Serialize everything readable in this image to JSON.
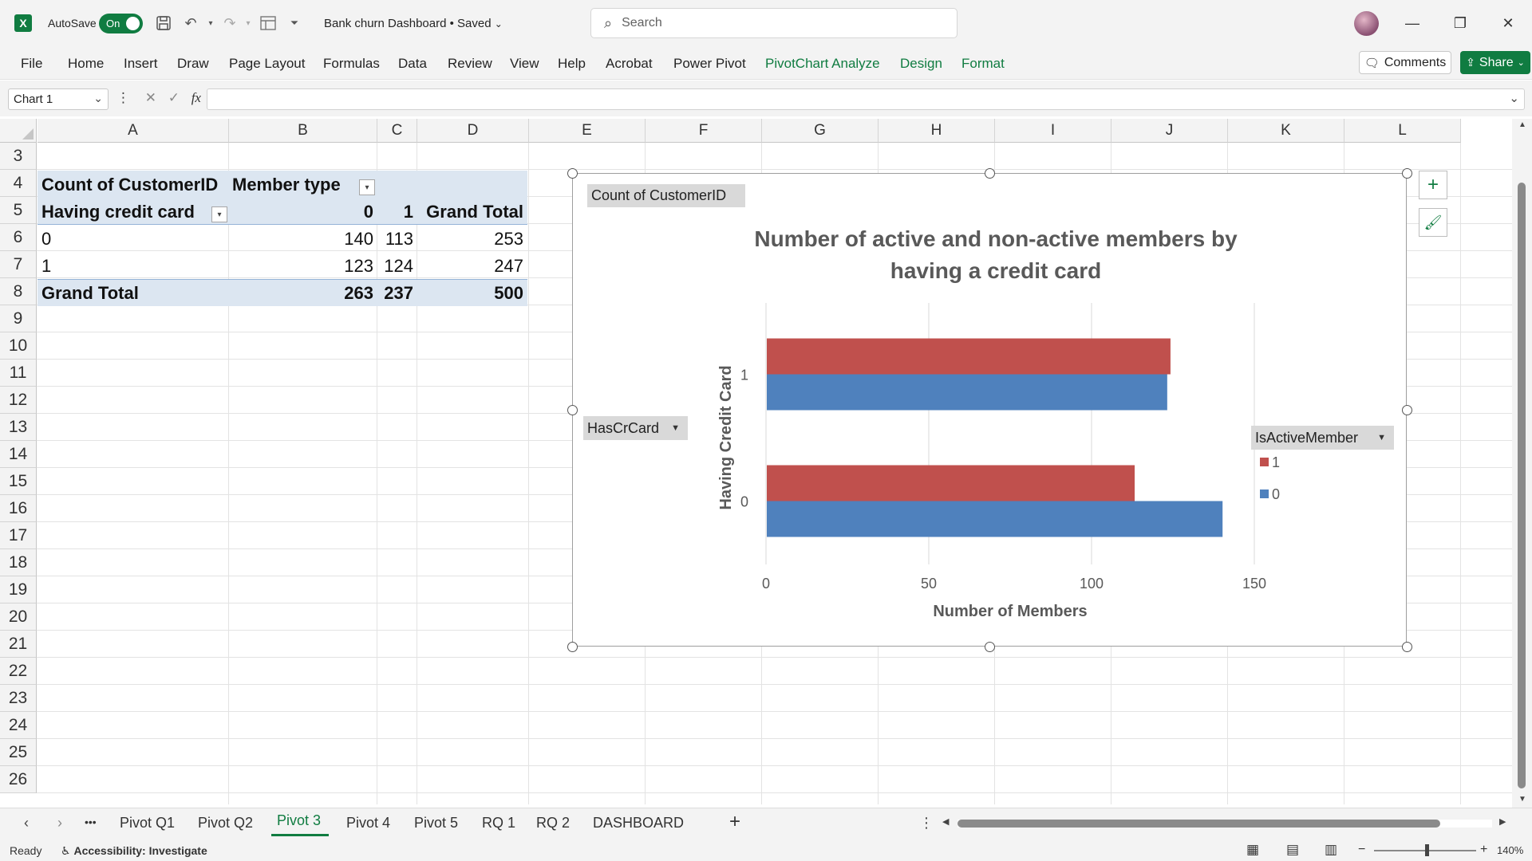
{
  "titlebar": {
    "app_logo": "X",
    "autosave_label": "AutoSave",
    "autosave_state": "On",
    "doc_title": "Bank churn Dashboard • Saved",
    "search_placeholder": "Search",
    "minimize": "—",
    "restore": "❐",
    "close": "✕"
  },
  "ribbon": {
    "tabs": [
      "File",
      "Home",
      "Insert",
      "Draw",
      "Page Layout",
      "Formulas",
      "Data",
      "Review",
      "View",
      "Help",
      "Acrobat",
      "Power Pivot",
      "PivotChart Analyze",
      "Design",
      "Format"
    ],
    "comments_label": "Comments",
    "share_label": "Share",
    "accent_color": "#107c41"
  },
  "formula_bar": {
    "name_box": "Chart 1",
    "fx": "fx",
    "value": ""
  },
  "grid": {
    "columns": [
      "A",
      "B",
      "C",
      "D",
      "E",
      "F",
      "G",
      "H",
      "I",
      "J",
      "K",
      "L"
    ],
    "rows": [
      "3",
      "4",
      "5",
      "6",
      "7",
      "8",
      "9",
      "10",
      "11",
      "12",
      "13",
      "14",
      "15",
      "16",
      "17",
      "18",
      "19",
      "20",
      "21",
      "22",
      "23",
      "24",
      "25",
      "26"
    ]
  },
  "pivot": {
    "value_field": "Count of CustomerID",
    "column_field": "Member type",
    "row_field": "Having credit card",
    "col_headers": [
      "0",
      "1",
      "Grand Total"
    ],
    "rows": [
      {
        "label": "0",
        "v0": "140",
        "v1": "113",
        "total": "253"
      },
      {
        "label": "1",
        "v0": "123",
        "v1": "124",
        "total": "247"
      }
    ],
    "grand_total": {
      "label": "Grand Total",
      "v0": "263",
      "v1": "237",
      "total": "500"
    },
    "header_fill": "#dce6f1"
  },
  "chart": {
    "value_field_button": "Count of CustomerID",
    "axis_field_button": "HasCrCard",
    "legend_field_button": "IsActiveMember",
    "plus_icon": "+",
    "brush_icon": "🖌"
  },
  "chart_data": {
    "type": "bar",
    "orientation": "horizontal",
    "title": "Number of active and non-active members by having a credit card",
    "xlabel": "Number of Members",
    "ylabel": "Having Credit Card",
    "categories": [
      "0",
      "1"
    ],
    "xlim": [
      0,
      150
    ],
    "xticks": [
      "0",
      "50",
      "100",
      "150"
    ],
    "grid": true,
    "legend_position": "right",
    "series": [
      {
        "name": "1",
        "color": "#c0504d",
        "values": [
          113,
          124
        ]
      },
      {
        "name": "0",
        "color": "#4f81bd",
        "values": [
          140,
          123
        ]
      }
    ]
  },
  "sheets": {
    "tabs": [
      "Pivot Q1",
      "Pivot Q2",
      "Pivot 3",
      "Pivot 4",
      "Pivot 5",
      "RQ 1",
      "RQ 2",
      "DASHBOARD"
    ],
    "active": "Pivot 3",
    "add": "+",
    "more": "•••"
  },
  "status": {
    "ready": "Ready",
    "accessibility": "Accessibility: Investigate",
    "zoom": "140%"
  }
}
